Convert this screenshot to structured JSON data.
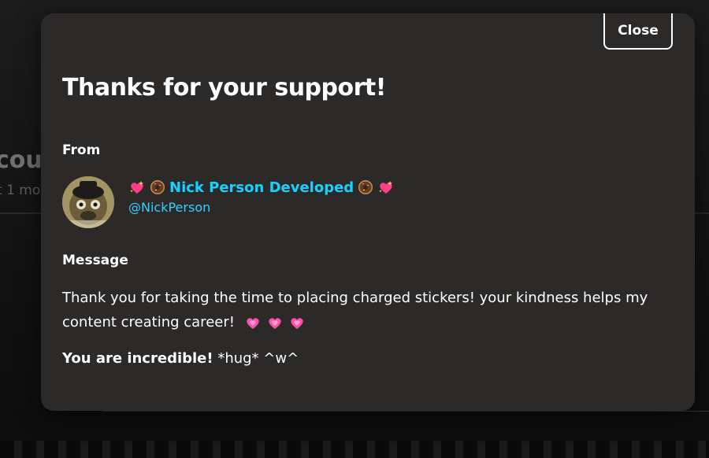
{
  "background": {
    "title_fragment": "cou",
    "subtitle_fragment": "t 1 mo"
  },
  "modal": {
    "close_label": "Close",
    "title": "Thanks for your support!",
    "from_label": "From",
    "message_label": "Message"
  },
  "sender": {
    "display_name": "Nick Person Developed",
    "handle": "@NickPerson",
    "name_prefix_icons": [
      "sparkling-heart-icon",
      "donut-icon"
    ],
    "name_suffix_icons": [
      "donut-icon",
      "sparkling-heart-icon"
    ],
    "name_color": "#13d4ff"
  },
  "message": {
    "text": "Thank you for taking the time to placing charged stickers! your kindness helps my content creating career!",
    "trailing_icons": [
      "pink-heart-icon",
      "pink-heart-icon",
      "pink-heart-icon"
    ],
    "closing_bold": "You are incredible!",
    "closing_rest": " *hug* ^w^"
  },
  "colors": {
    "modal_bg": "#2c2a29",
    "accent": "#13d4ff",
    "heart": "#ff4fa8"
  }
}
